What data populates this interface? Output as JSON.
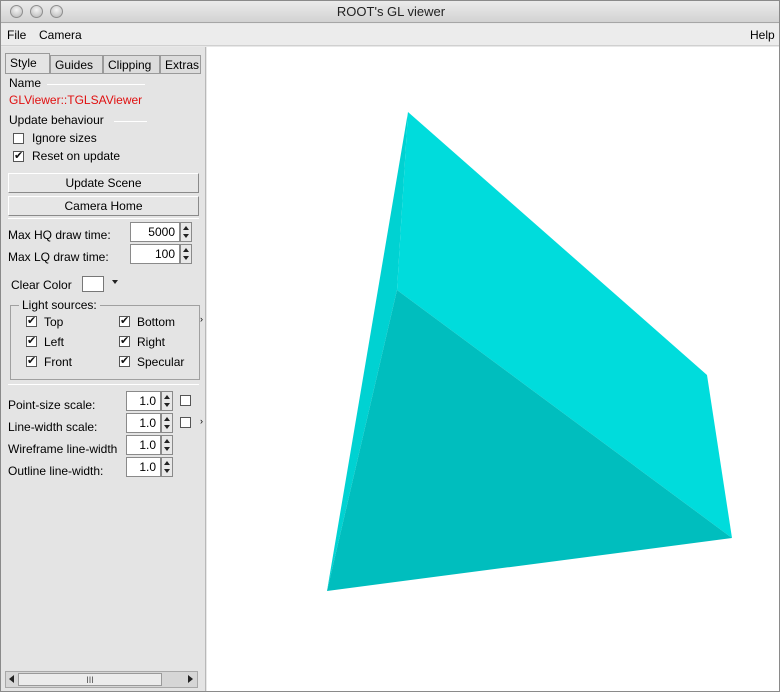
{
  "window": {
    "title": "ROOT's GL viewer"
  },
  "menubar": {
    "file": "File",
    "camera": "Camera",
    "help": "Help"
  },
  "tabs": [
    "Style",
    "Guides",
    "Clipping",
    "Extras"
  ],
  "style": {
    "name_label": "Name",
    "name_value": "GLViewer::TGLSAViewer",
    "update_label": "Update behaviour",
    "ignore_sizes": "Ignore sizes",
    "ignore_sizes_checked": false,
    "reset_on_update": "Reset on update",
    "reset_on_update_checked": true,
    "update_scene_button": "Update Scene",
    "camera_home_button": "Camera Home",
    "max_hq_label": "Max HQ draw time:",
    "max_hq_value": "5000",
    "max_lq_label": "Max LQ draw time:",
    "max_lq_value": "100",
    "clear_color_label": "Clear Color",
    "clear_color": "#ffffff",
    "light_sources_label": "Light sources:",
    "lights": {
      "top": "Top",
      "top_on": true,
      "bottom": "Bottom",
      "bottom_on": true,
      "left": "Left",
      "left_on": true,
      "right": "Right",
      "right_on": true,
      "front": "Front",
      "front_on": true,
      "specular": "Specular",
      "specular_on": true
    },
    "point_size_label": "Point-size scale:",
    "point_size_value": "1.0",
    "line_width_label": "Line-width scale:",
    "line_width_value": "1.0",
    "wireframe_label": "Wireframe line-width",
    "wireframe_value": "1.0",
    "outline_label": "Outline line-width:",
    "outline_value": "1.0",
    "scroll_thumb_glyph": "III"
  },
  "viewer": {
    "background": "#ffffff",
    "shape_color_light": "#00dddd",
    "shape_color_mid": "#00cccc",
    "shape_color_dark": "#00bcbc"
  }
}
